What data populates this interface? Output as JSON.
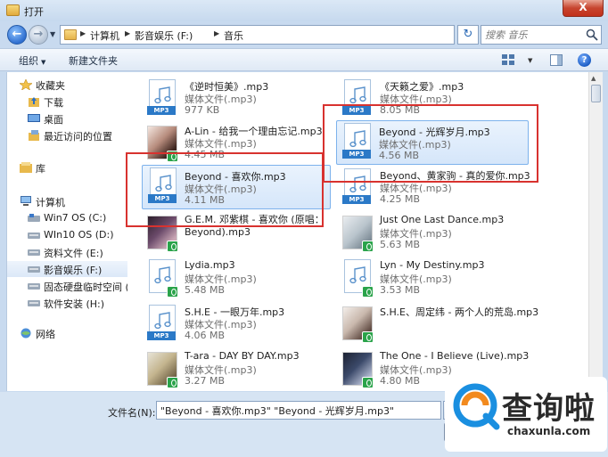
{
  "window": {
    "title": "打开",
    "close_label": "X"
  },
  "address": {
    "crumbs": [
      "计算机",
      "影音娱乐 (F:)",
      "音乐"
    ]
  },
  "search": {
    "placeholder": "搜索 音乐"
  },
  "toolbar": {
    "organize": "组织",
    "new_folder": "新建文件夹"
  },
  "nav": {
    "favorites": "收藏夹",
    "downloads": "下载",
    "desktop": "桌面",
    "recent": "最近访问的位置",
    "libraries": "库",
    "computer": "计算机",
    "drives": [
      "Win7 OS (C:)",
      "WIn10 OS (D:)",
      "资料文件 (E:)",
      "影音娱乐 (F:)",
      "固态硬盘临时空间 (G",
      "软件安装 (H:)"
    ],
    "network": "网络"
  },
  "files": [
    {
      "name": "《逆时恒美》.mp3",
      "type": "媒体文件(.mp3)",
      "size": "977 KB"
    },
    {
      "name": "《天籁之爱》.mp3",
      "type": "媒体文件(.mp3)",
      "size": "8.05 MB"
    },
    {
      "name": "A-Lin - 给我一个理由忘记.mp3",
      "type": "媒体文件(.mp3)",
      "size": "4.45 MB"
    },
    {
      "name": "Beyond - 光辉岁月.mp3",
      "type": "媒体文件(.mp3)",
      "size": "4.56 MB"
    },
    {
      "name": "Beyond - 喜欢你.mp3",
      "type": "媒体文件(.mp3)",
      "size": "4.11 MB"
    },
    {
      "name": "Beyond、黄家驹 - 真的爱你.mp3",
      "type": "媒体文件(.mp3)",
      "size": "4.25 MB"
    },
    {
      "name": "G.E.M. 邓紫棋 - 喜欢你 (原唱：Beyond).mp3",
      "type": "",
      "size": ""
    },
    {
      "name": "Just One Last Dance.mp3",
      "type": "媒体文件(.mp3)",
      "size": "5.63 MB"
    },
    {
      "name": "Lydia.mp3",
      "type": "媒体文件(.mp3)",
      "size": "5.48 MB"
    },
    {
      "name": "Lyn - My Destiny.mp3",
      "type": "媒体文件(.mp3)",
      "size": "3.53 MB"
    },
    {
      "name": "S.H.E - 一眼万年.mp3",
      "type": "媒体文件(.mp3)",
      "size": "4.06 MB"
    },
    {
      "name": "S.H.E、周定纬 - 两个人的荒岛.mp3",
      "type": "",
      "size": ""
    },
    {
      "name": "T-ara - DAY BY DAY.mp3",
      "type": "媒体文件(.mp3)",
      "size": "3.27 MB"
    },
    {
      "name": "The One - I Believe (Live).mp3",
      "type": "媒体文件(.mp3)",
      "size": "4.80 MB"
    }
  ],
  "mp3_tag": "MP3",
  "filename": {
    "label": "文件名(N):",
    "value": "\"Beyond - 喜欢你.mp3\" \"Beyond - 光辉岁月.mp3\""
  },
  "watermark": {
    "text": "查询啦",
    "url": "chaxunla.com"
  },
  "colors": {
    "highlight": "#d8322f",
    "selection": "#d5e6fa",
    "mp3_tag": "#2b79c7",
    "green_badge": "#2aa34a"
  }
}
